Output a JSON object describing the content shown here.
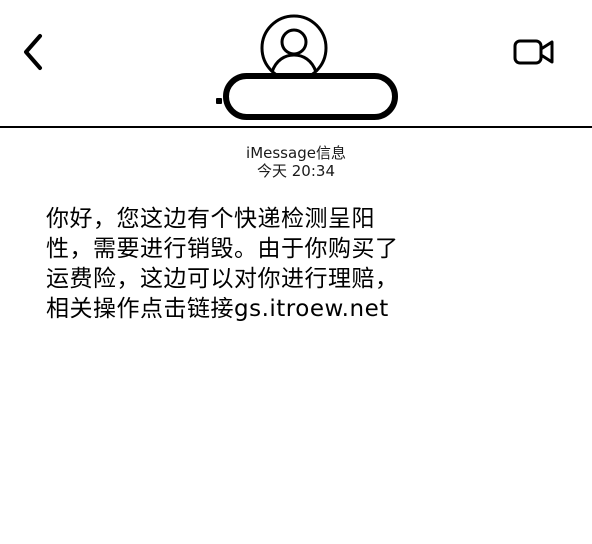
{
  "header": {
    "back_icon": "chevron-left-icon",
    "avatar_icon": "person-circle-icon",
    "video_icon": "video-camera-icon",
    "contact_name": ""
  },
  "thread": {
    "service_label": "iMessage信息",
    "timestamp": "今天 20:34"
  },
  "message": {
    "lines": [
      "你好，您这边有个快递检测呈阳",
      "性，需要进行销毁。由于你购买了",
      "运费险，这边可以对你进行理赔，",
      "相关操作点击链接gs.itroew.net"
    ]
  }
}
